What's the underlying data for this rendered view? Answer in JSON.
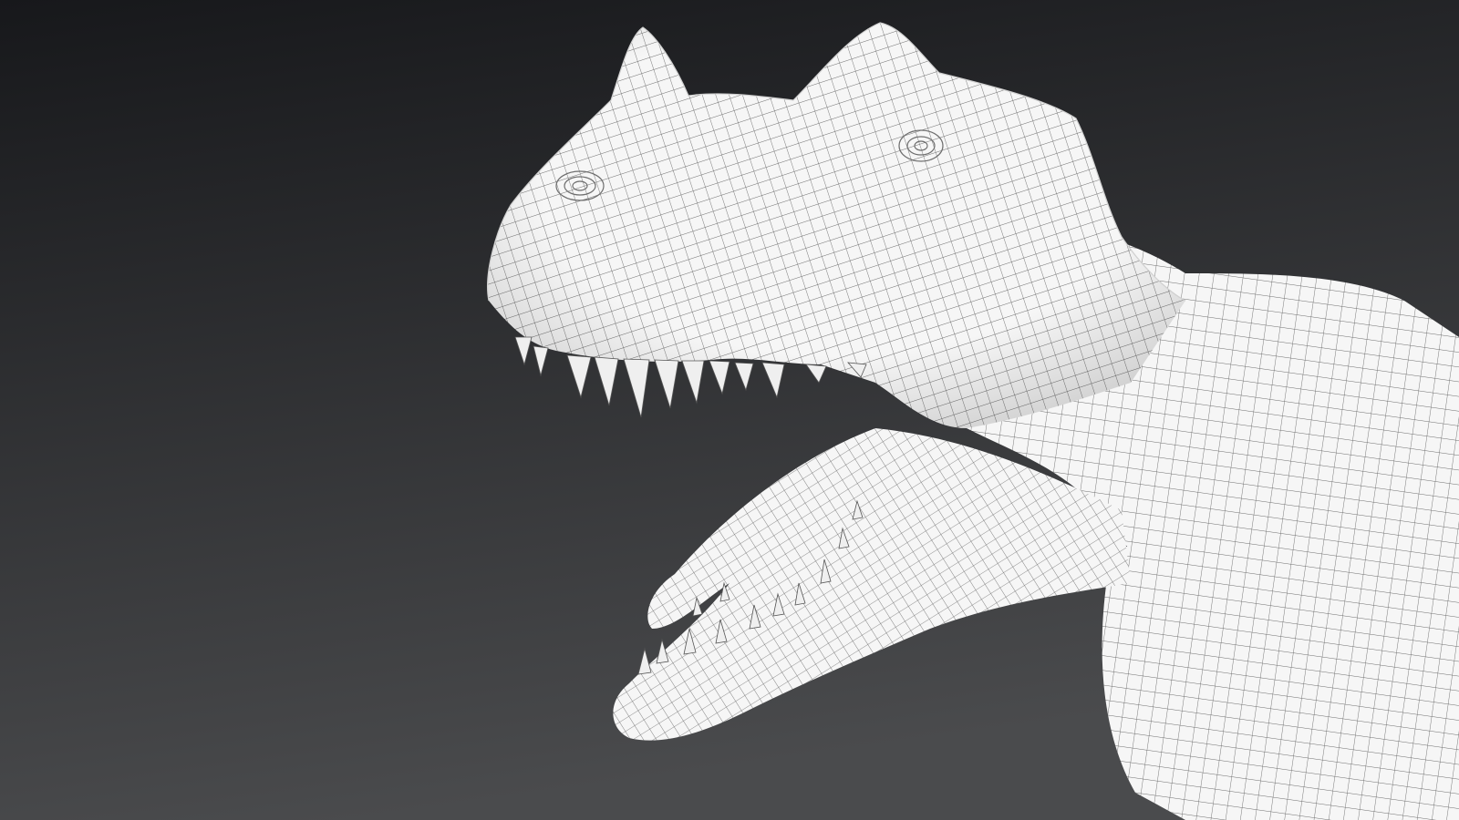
{
  "scene": {
    "subject": "dinosaur-wireframe-mesh",
    "colors": {
      "background_top": "#17181b",
      "background_bottom": "#4a4b4d",
      "mesh_fill": "#f6f6f6",
      "wire_line": "#6e6e6e",
      "tooth_fill": "#efefef",
      "tooth_tip": "#2a2a2a"
    }
  }
}
